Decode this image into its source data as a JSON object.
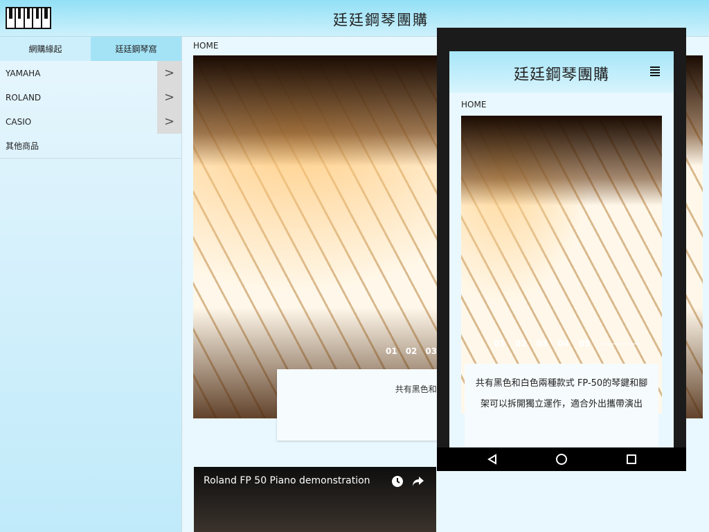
{
  "header": {
    "title": "廷廷鋼琴團購"
  },
  "sidebar": {
    "tabs": [
      "網購緣起",
      "廷廷鋼琴窩"
    ],
    "items": [
      {
        "label": "YAMAHA",
        "has_submenu": true
      },
      {
        "label": "ROLAND",
        "has_submenu": true
      },
      {
        "label": "CASIO",
        "has_submenu": true
      },
      {
        "label": "其他商品",
        "has_submenu": false
      }
    ],
    "arrow": ">"
  },
  "main": {
    "breadcrumb": "HOME",
    "slider_dots": [
      "01",
      "02",
      "03"
    ],
    "caption_line1": "共有黑色和白色兩種款式 FP-50",
    "caption_line2": "作，適合外",
    "video_title": "Roland FP 50 Piano demonstration"
  },
  "phone": {
    "title": "廷廷鋼琴團購",
    "breadcrumb": "HOME",
    "slider_dots": [
      "01",
      "02",
      "03",
      "04",
      "05"
    ],
    "caption": "共有黑色和白色兩種款式 FP-50的琴鍵和腳架可以拆開獨立運作，適合外出攜帶演出"
  },
  "icons": {
    "menu": "hamburger-menu-icon",
    "clock": "watch-later-icon",
    "share": "share-icon",
    "back": "back-icon",
    "home": "home-icon",
    "recents": "recent-apps-icon"
  },
  "colors": {
    "header_gradient_top": "#92e0f6",
    "sidebar_active_tab": "#a4e3f6",
    "page_background": "#e9f8fe"
  }
}
